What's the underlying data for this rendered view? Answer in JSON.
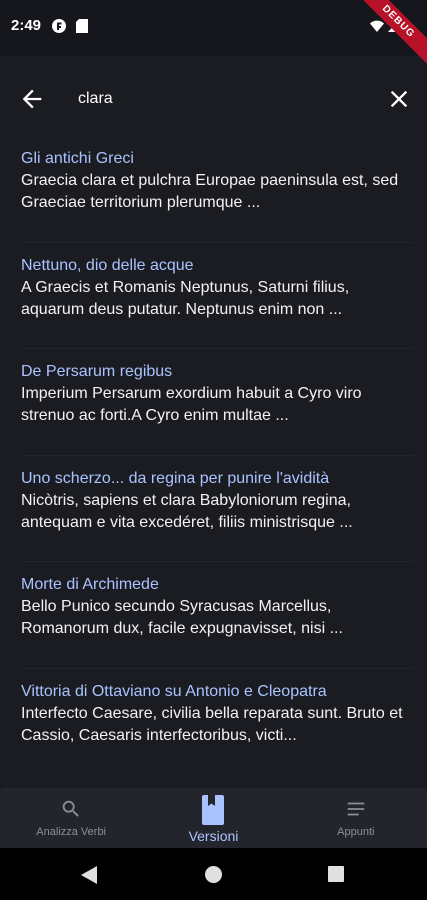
{
  "status": {
    "time": "2:49",
    "debug_label": "DEBUG"
  },
  "search": {
    "query": "clara"
  },
  "results": [
    {
      "title": "Gli antichi Greci",
      "snippet": "Graecia clara et pulchra Europae paeninsula est, sed Graeciae territorium plerumque ..."
    },
    {
      "title": "Nettuno, dio delle acque",
      "snippet": "A Graecis et Romanis Neptunus, Saturni filius, aquarum deus putatur. Neptunus enim non ..."
    },
    {
      "title": "De Persarum regibus",
      "snippet": "Imperium Persarum exordium habuit a Cyro viro strenuo ac forti.A Cyro enim multae ..."
    },
    {
      "title": "Uno scherzo... da regina per punire l'avidità",
      "snippet": "Nicòtris, sapiens et clara Babyloniorum regina, antequam e vita excedéret, filiis ministrisque ..."
    },
    {
      "title": "Morte di Archimede",
      "snippet": "Bello Punico secundo Syracusas Marcellus, Romanorum dux, facile expugnavisset, nisi ..."
    },
    {
      "title": "Vittoria di Ottaviano su Antonio e Cleopatra",
      "snippet": "Interfecto Caesare, civilia bella reparata sunt. Bruto et Cassio, Caesaris interfectoribus, victi..."
    }
  ],
  "nav": {
    "items": [
      {
        "label": "Analizza Verbi",
        "icon": "search-icon"
      },
      {
        "label": "Versioni",
        "icon": "book-icon",
        "active": true
      },
      {
        "label": "Appunti",
        "icon": "notes-icon"
      }
    ]
  },
  "colors": {
    "accent": "#a9c3ff",
    "background": "#1b1c22",
    "nav_bg": "#24252c"
  }
}
